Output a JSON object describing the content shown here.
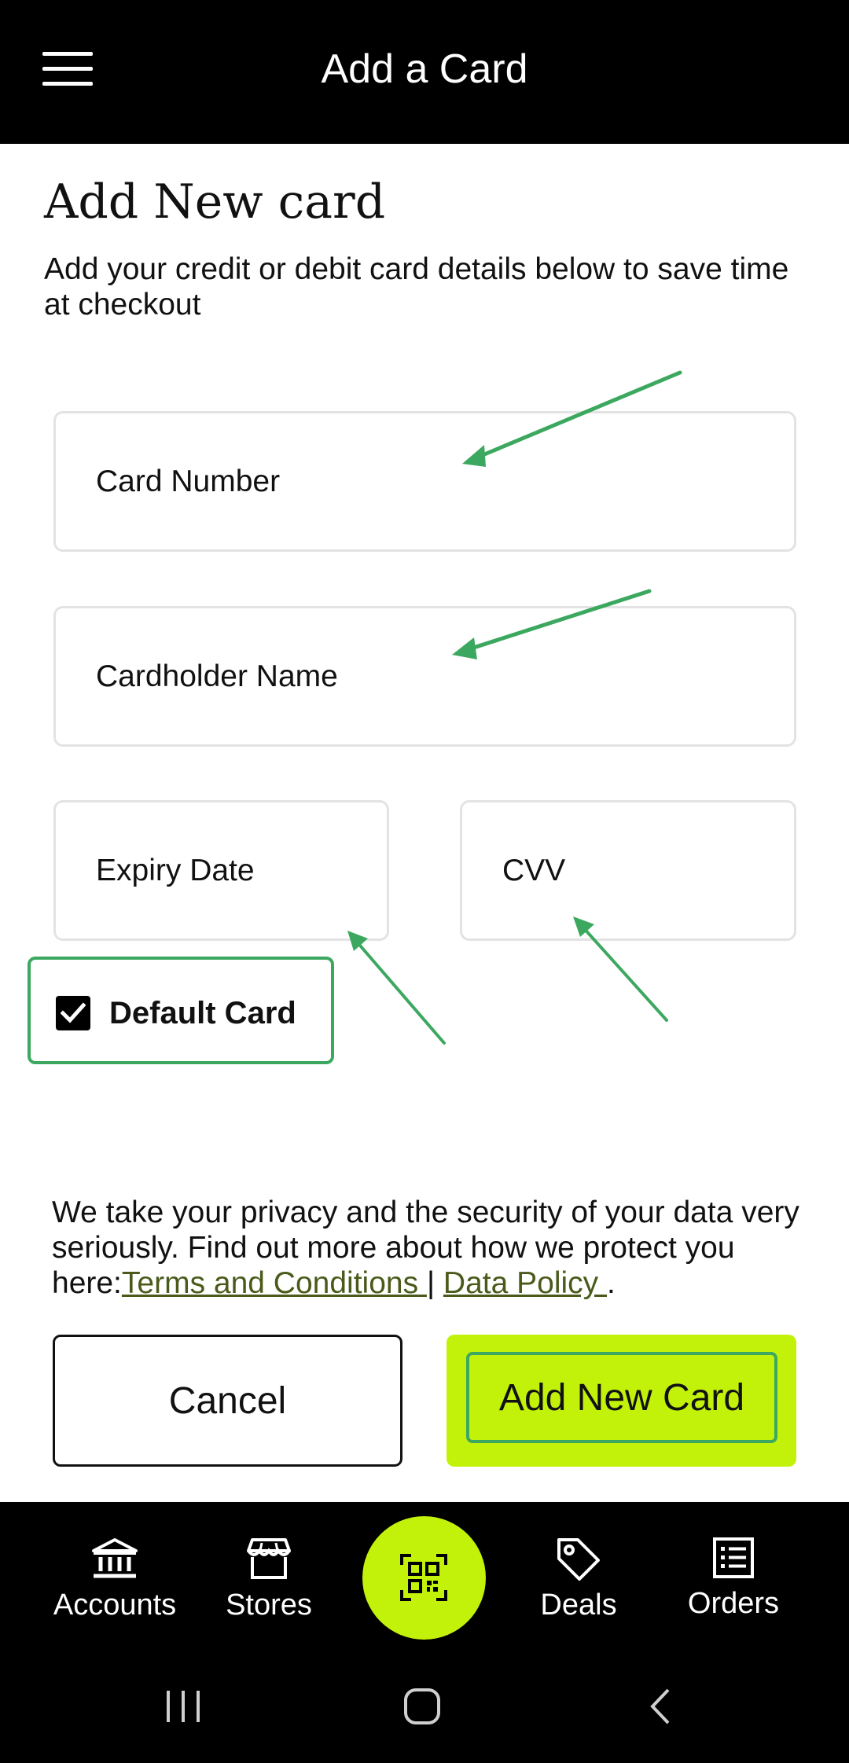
{
  "header": {
    "title": "Add a Card",
    "menu_icon": "hamburger-menu-icon"
  },
  "form": {
    "heading": "Add New card",
    "subtitle": "Add your credit or debit card details below to save time at checkout",
    "fields": {
      "card_number": "Card Number",
      "cardholder_name": "Cardholder Name",
      "expiry_date": "Expiry Date",
      "cvv": "CVV"
    },
    "default_card": {
      "label": "Default Card",
      "checked": true
    }
  },
  "privacy": {
    "text": "We take your privacy and the security of your data very seriously. Find out more about how we protect you here:",
    "terms_link": "Terms and Conditions ",
    "separator": "|",
    "policy_link": "Data Policy ",
    "end": "."
  },
  "actions": {
    "cancel_label": "Cancel",
    "add_label": "Add New Card"
  },
  "bottom_nav": {
    "items": [
      {
        "label": "Accounts",
        "icon": "bank-icon"
      },
      {
        "label": "Stores",
        "icon": "store-icon"
      },
      {
        "label": "",
        "icon": "qr-code-icon"
      },
      {
        "label": "Deals",
        "icon": "tag-icon"
      },
      {
        "label": "Orders",
        "icon": "list-icon"
      }
    ]
  },
  "colors": {
    "accent": "#c3f20a",
    "focus_green": "#3ca85f",
    "link": "#4a5a1a",
    "bar": "#000000"
  }
}
